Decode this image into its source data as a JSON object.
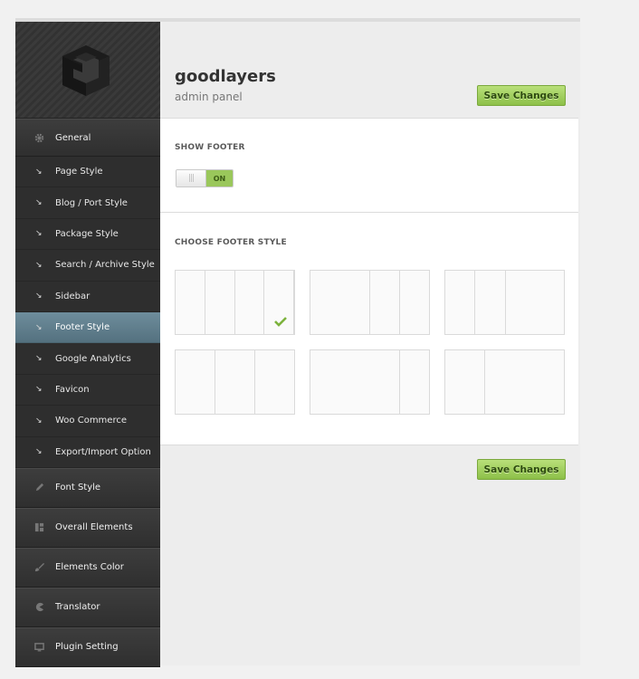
{
  "brand": {
    "title": "goodlayers",
    "subtitle": "admin panel"
  },
  "actions": {
    "save_label": "Save Changes"
  },
  "sidebar": {
    "main_general": {
      "label": "General",
      "icon": "gear-icon"
    },
    "sub_items": [
      {
        "label": "Page Style"
      },
      {
        "label": "Blog / Port Style"
      },
      {
        "label": "Package Style"
      },
      {
        "label": "Search / Archive Style"
      },
      {
        "label": "Sidebar"
      },
      {
        "label": "Footer Style",
        "active": true
      },
      {
        "label": "Google Analytics"
      },
      {
        "label": "Favicon"
      },
      {
        "label": "Woo Commerce"
      },
      {
        "label": "Export/Import Option"
      }
    ],
    "main_items": [
      {
        "label": "Font Style",
        "icon": "pencil-icon"
      },
      {
        "label": "Overall Elements",
        "icon": "grid-icon"
      },
      {
        "label": "Elements Color",
        "icon": "brush-icon"
      },
      {
        "label": "Translator",
        "icon": "pacman-icon"
      },
      {
        "label": "Plugin Setting",
        "icon": "monitor-icon"
      }
    ]
  },
  "show_footer": {
    "title": "SHOW FOOTER",
    "toggle_knob": "|||",
    "toggle_state": "ON"
  },
  "footer_style": {
    "title": "CHOOSE FOOTER STYLE",
    "options": [
      {
        "columns": [
          1,
          1,
          1,
          1
        ],
        "selected": true
      },
      {
        "columns": [
          2,
          1,
          1
        ],
        "selected": false
      },
      {
        "columns": [
          1,
          1,
          2
        ],
        "selected": false
      },
      {
        "columns": [
          1,
          1,
          1
        ],
        "selected": false
      },
      {
        "columns": [
          3,
          1
        ],
        "selected": false
      },
      {
        "columns": [
          1,
          2
        ],
        "selected": false
      }
    ]
  },
  "colors": {
    "accent_green": "#9ac75b",
    "active_menu": "#5f7e8c",
    "sidebar_bg": "#333333"
  }
}
